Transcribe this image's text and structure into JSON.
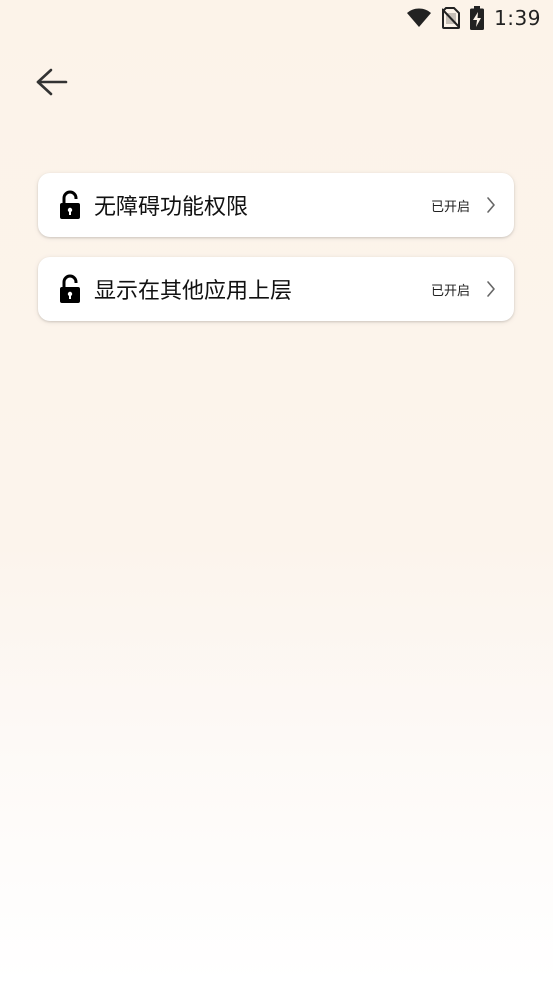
{
  "status_bar": {
    "time": "1:39",
    "icons": [
      "wifi-icon",
      "no-sim-icon",
      "battery-charging-icon"
    ]
  },
  "nav": {
    "back_icon": "arrow-left-icon"
  },
  "permissions": [
    {
      "label": "无障碍功能权限",
      "status": "已开启",
      "icon": "unlock-icon"
    },
    {
      "label": "显示在其他应用上层",
      "status": "已开启",
      "icon": "unlock-icon"
    }
  ],
  "colors": {
    "background_top": "#fcf3e9",
    "background_bottom": "#ffffff",
    "card": "#ffffff",
    "text": "#111111"
  }
}
